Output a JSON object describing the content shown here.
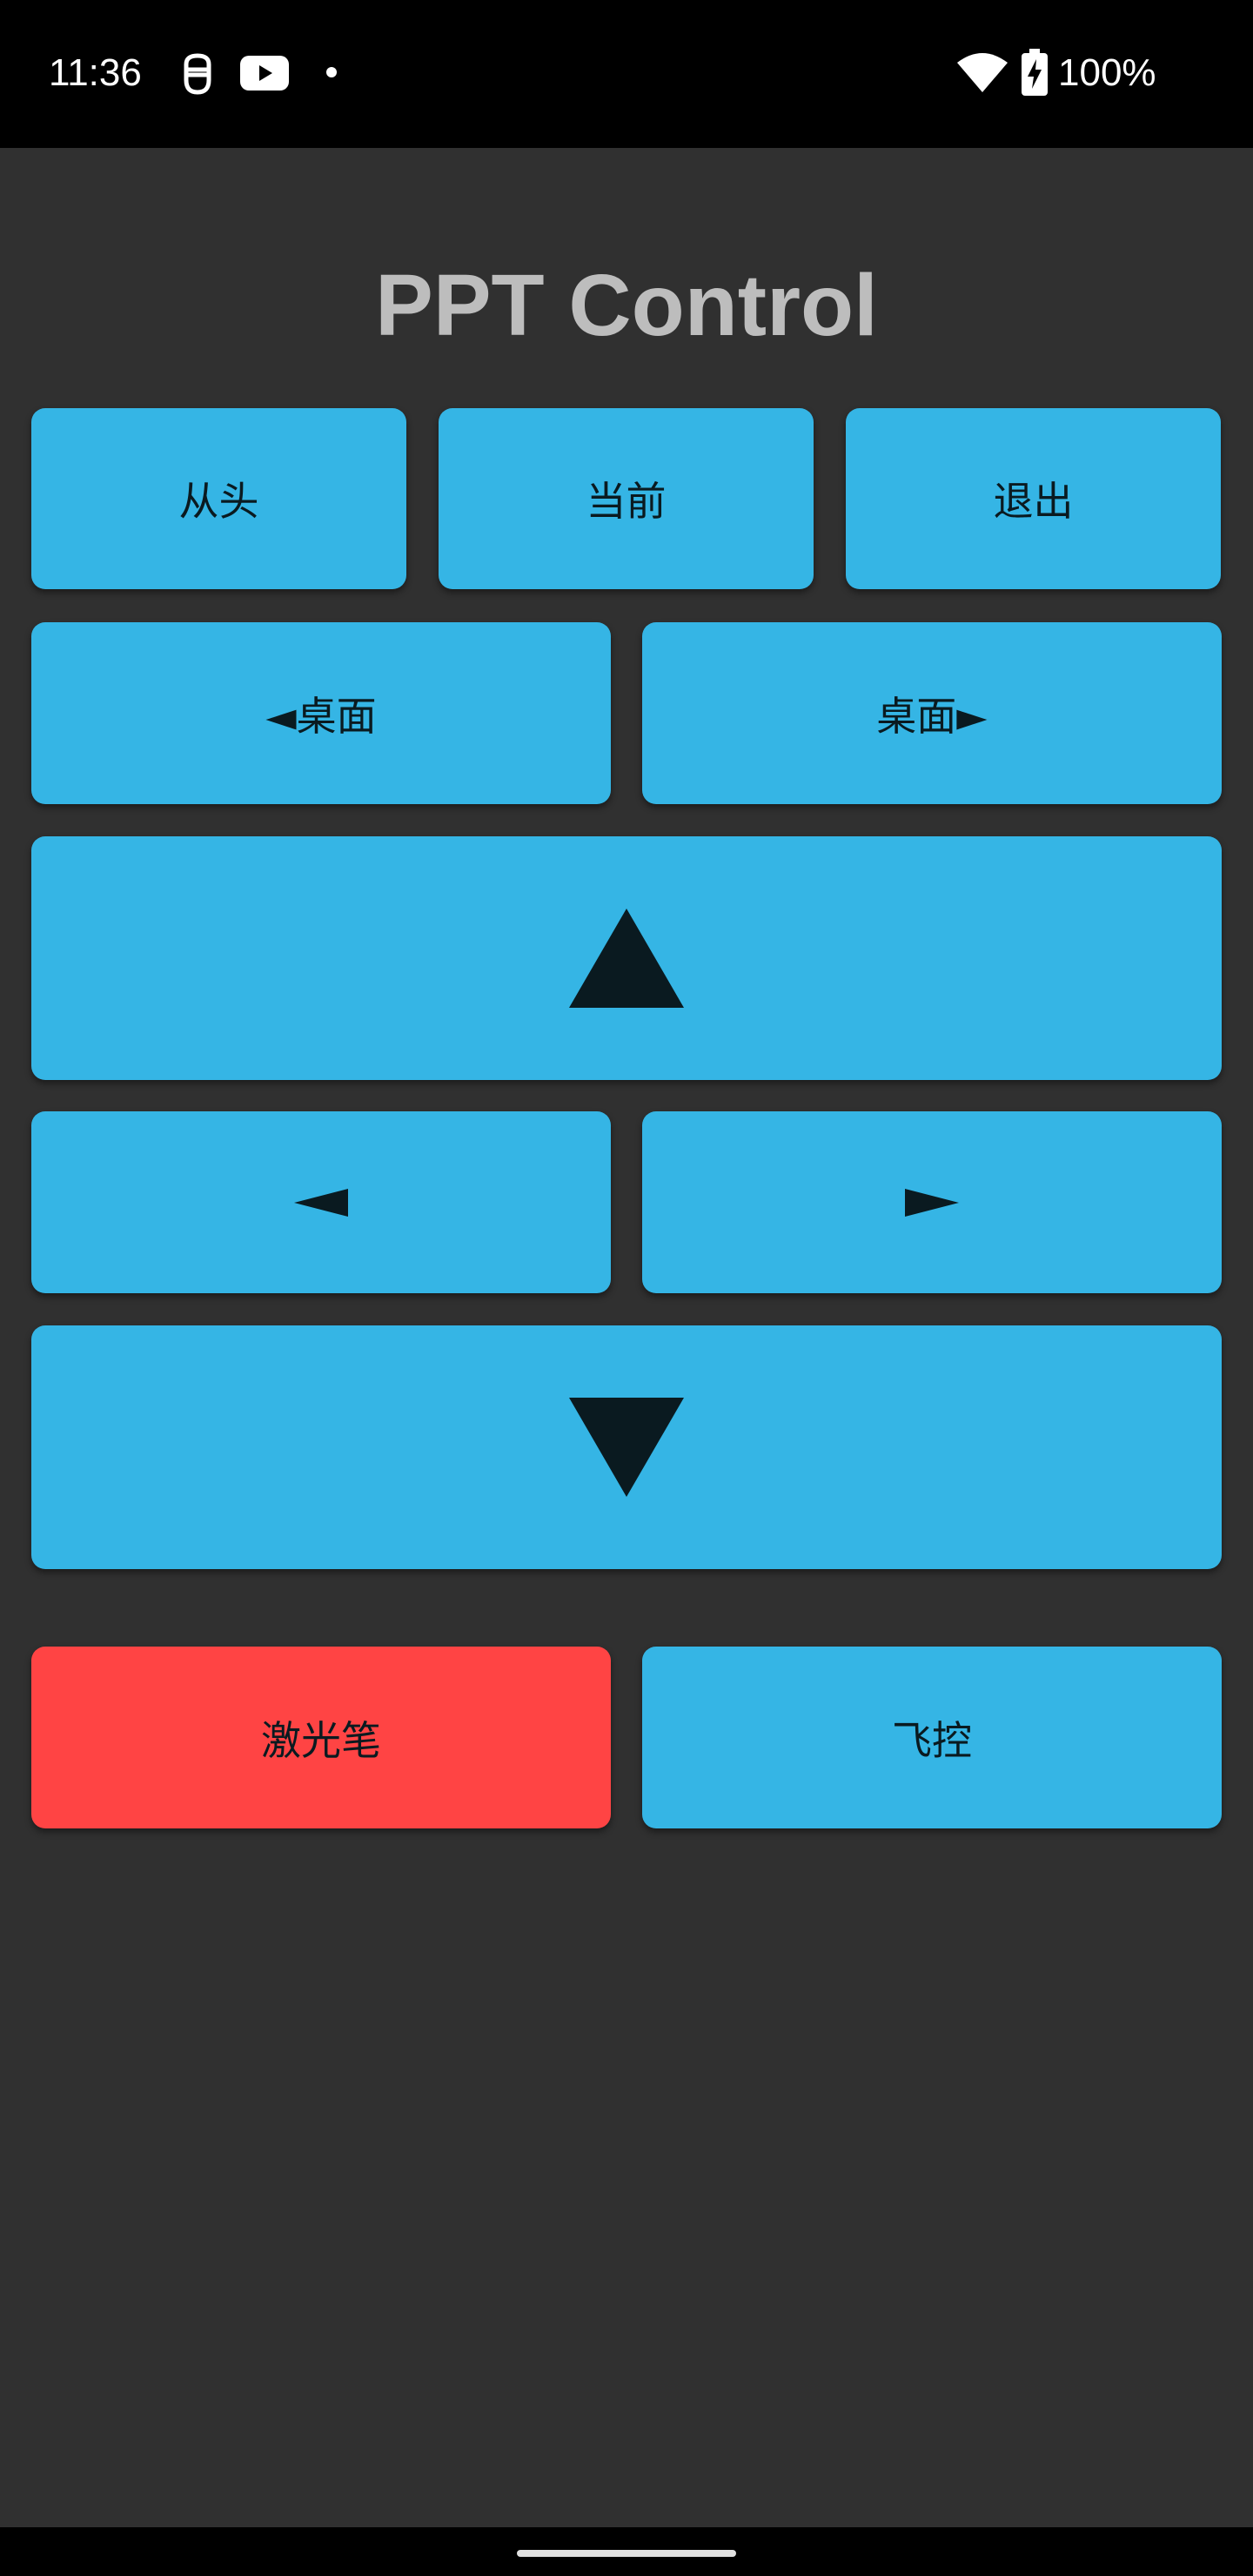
{
  "status_bar": {
    "time": "11:36",
    "notification_icons": [
      "face-icon",
      "youtube-icon",
      "dot-icon"
    ],
    "system_icons": [
      "wifi-icon",
      "battery-charging-icon"
    ],
    "battery": "100%"
  },
  "app": {
    "title": "PPT Control",
    "colors": {
      "background": "#303030",
      "button": "#35b5e5",
      "laser_button": "#ff4444",
      "title": "#bdbdbd"
    }
  },
  "buttons": {
    "from_start": "从头",
    "current": "当前",
    "exit": "退出",
    "desktop_prev": "◄桌面",
    "desktop_next": "桌面►",
    "up_icon": "triangle-up-icon",
    "left_icon": "triangle-left-icon",
    "right_icon": "triangle-right-icon",
    "down_icon": "triangle-down-icon",
    "laser": "激光笔",
    "air_control": "飞控"
  }
}
